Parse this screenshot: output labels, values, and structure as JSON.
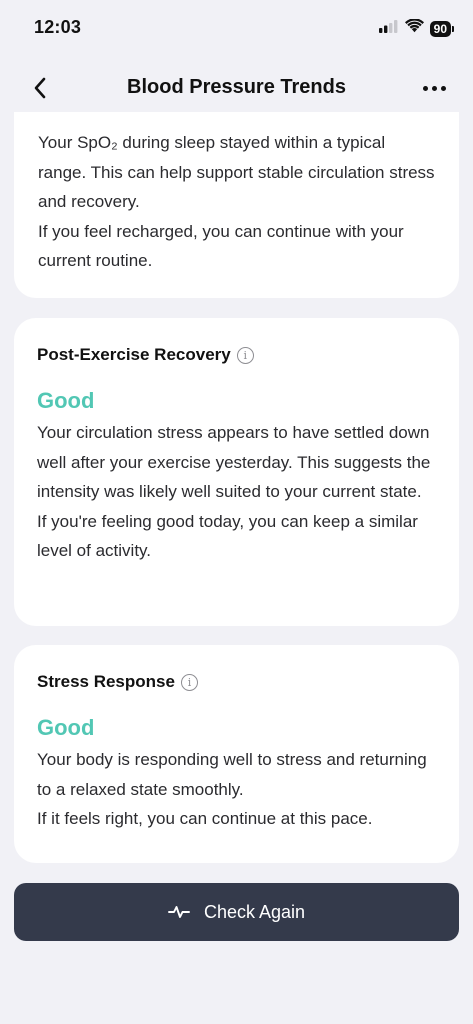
{
  "status_bar": {
    "time": "12:03",
    "battery": "90"
  },
  "nav": {
    "title": "Blood Pressure Trends"
  },
  "cards": [
    {
      "body": [
        "Your SpO₂ during sleep stayed within a typical range. This can help support stable circulation stress and recovery.",
        "If you feel recharged, you can continue with your current routine."
      ]
    },
    {
      "title": "Post-Exercise Recovery",
      "status": "Good",
      "body": [
        "Your circulation stress appears to have settled down well after your exercise yesterday. This suggests the intensity was likely well suited to your current state.",
        "If you're feeling good today, you can keep a similar level of activity."
      ]
    },
    {
      "title": "Stress Response",
      "status": "Good",
      "body": [
        "Your body is responding well to stress and returning to a relaxed state smoothly.",
        "If it feels right, you can continue at this pace."
      ]
    }
  ],
  "button": {
    "label": "Check Again"
  },
  "colors": {
    "accent_good": "#52c7b4",
    "button_bg": "#343a4b",
    "page_bg": "#f1f1f6"
  },
  "icons": {
    "back": "chevron-left-icon",
    "more": "more-horizontal-icon",
    "info": "info-icon",
    "pulse": "pulse-icon",
    "signal": "signal-icon",
    "wifi": "wifi-icon",
    "battery": "battery-icon"
  }
}
